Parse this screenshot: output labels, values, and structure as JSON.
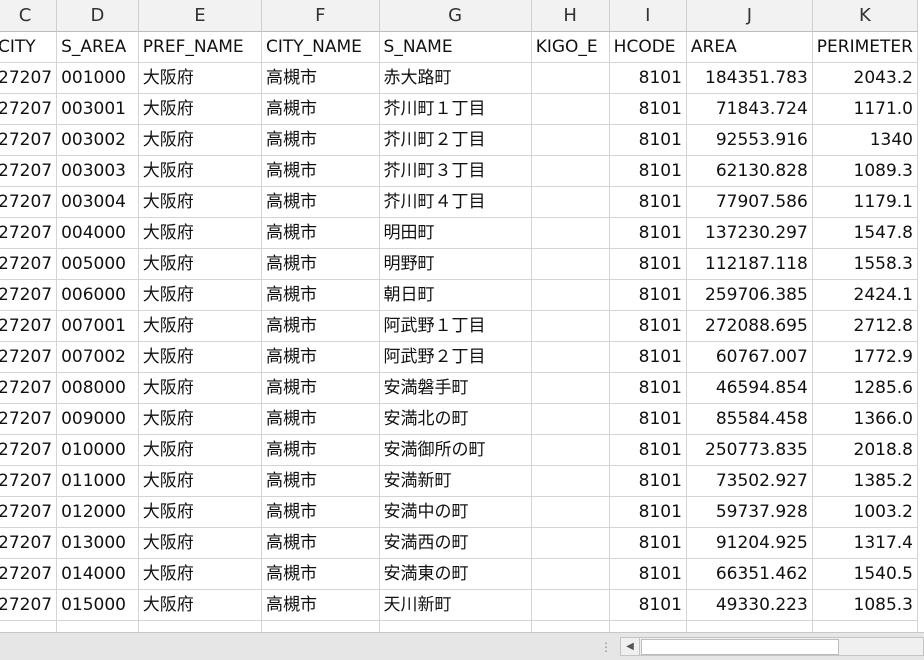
{
  "sheet": {
    "column_letters": [
      "C",
      "D",
      "E",
      "F",
      "G",
      "H",
      "I",
      "J",
      "K"
    ],
    "headers": [
      "CITY",
      "S_AREA",
      "PREF_NAME",
      "CITY_NAME",
      "S_NAME",
      "KIGO_E",
      "HCODE",
      "AREA",
      "PERIMETER"
    ],
    "rows": [
      [
        "27207",
        "001000",
        "大阪府",
        "高槻市",
        "赤大路町",
        "",
        "8101",
        "184351.783",
        "2043.2"
      ],
      [
        "27207",
        "003001",
        "大阪府",
        "高槻市",
        "芥川町１丁目",
        "",
        "8101",
        "71843.724",
        "1171.0"
      ],
      [
        "27207",
        "003002",
        "大阪府",
        "高槻市",
        "芥川町２丁目",
        "",
        "8101",
        "92553.916",
        "1340"
      ],
      [
        "27207",
        "003003",
        "大阪府",
        "高槻市",
        "芥川町３丁目",
        "",
        "8101",
        "62130.828",
        "1089.3"
      ],
      [
        "27207",
        "003004",
        "大阪府",
        "高槻市",
        "芥川町４丁目",
        "",
        "8101",
        "77907.586",
        "1179.1"
      ],
      [
        "27207",
        "004000",
        "大阪府",
        "高槻市",
        "明田町",
        "",
        "8101",
        "137230.297",
        "1547.8"
      ],
      [
        "27207",
        "005000",
        "大阪府",
        "高槻市",
        "明野町",
        "",
        "8101",
        "112187.118",
        "1558.3"
      ],
      [
        "27207",
        "006000",
        "大阪府",
        "高槻市",
        "朝日町",
        "",
        "8101",
        "259706.385",
        "2424.1"
      ],
      [
        "27207",
        "007001",
        "大阪府",
        "高槻市",
        "阿武野１丁目",
        "",
        "8101",
        "272088.695",
        "2712.8"
      ],
      [
        "27207",
        "007002",
        "大阪府",
        "高槻市",
        "阿武野２丁目",
        "",
        "8101",
        "60767.007",
        "1772.9"
      ],
      [
        "27207",
        "008000",
        "大阪府",
        "高槻市",
        "安満磐手町",
        "",
        "8101",
        "46594.854",
        "1285.6"
      ],
      [
        "27207",
        "009000",
        "大阪府",
        "高槻市",
        "安満北の町",
        "",
        "8101",
        "85584.458",
        "1366.0"
      ],
      [
        "27207",
        "010000",
        "大阪府",
        "高槻市",
        "安満御所の町",
        "",
        "8101",
        "250773.835",
        "2018.8"
      ],
      [
        "27207",
        "011000",
        "大阪府",
        "高槻市",
        "安満新町",
        "",
        "8101",
        "73502.927",
        "1385.2"
      ],
      [
        "27207",
        "012000",
        "大阪府",
        "高槻市",
        "安満中の町",
        "",
        "8101",
        "59737.928",
        "1003.2"
      ],
      [
        "27207",
        "013000",
        "大阪府",
        "高槻市",
        "安満西の町",
        "",
        "8101",
        "91204.925",
        "1317.4"
      ],
      [
        "27207",
        "014000",
        "大阪府",
        "高槻市",
        "安満東の町",
        "",
        "8101",
        "66351.462",
        "1540.5"
      ],
      [
        "27207",
        "015000",
        "大阪府",
        "高槻市",
        "天川新町",
        "",
        "8101",
        "49330.223",
        "1085.3"
      ],
      [
        "",
        "",
        "",
        "",
        "",
        "",
        "",
        "",
        ""
      ]
    ]
  },
  "statusbar": {
    "splitter_glyph": "⋮",
    "scroll_left_glyph": "◀"
  },
  "icons": {
    "splitter": "split-handle-icon",
    "scroll_left": "triangle-left-icon"
  }
}
